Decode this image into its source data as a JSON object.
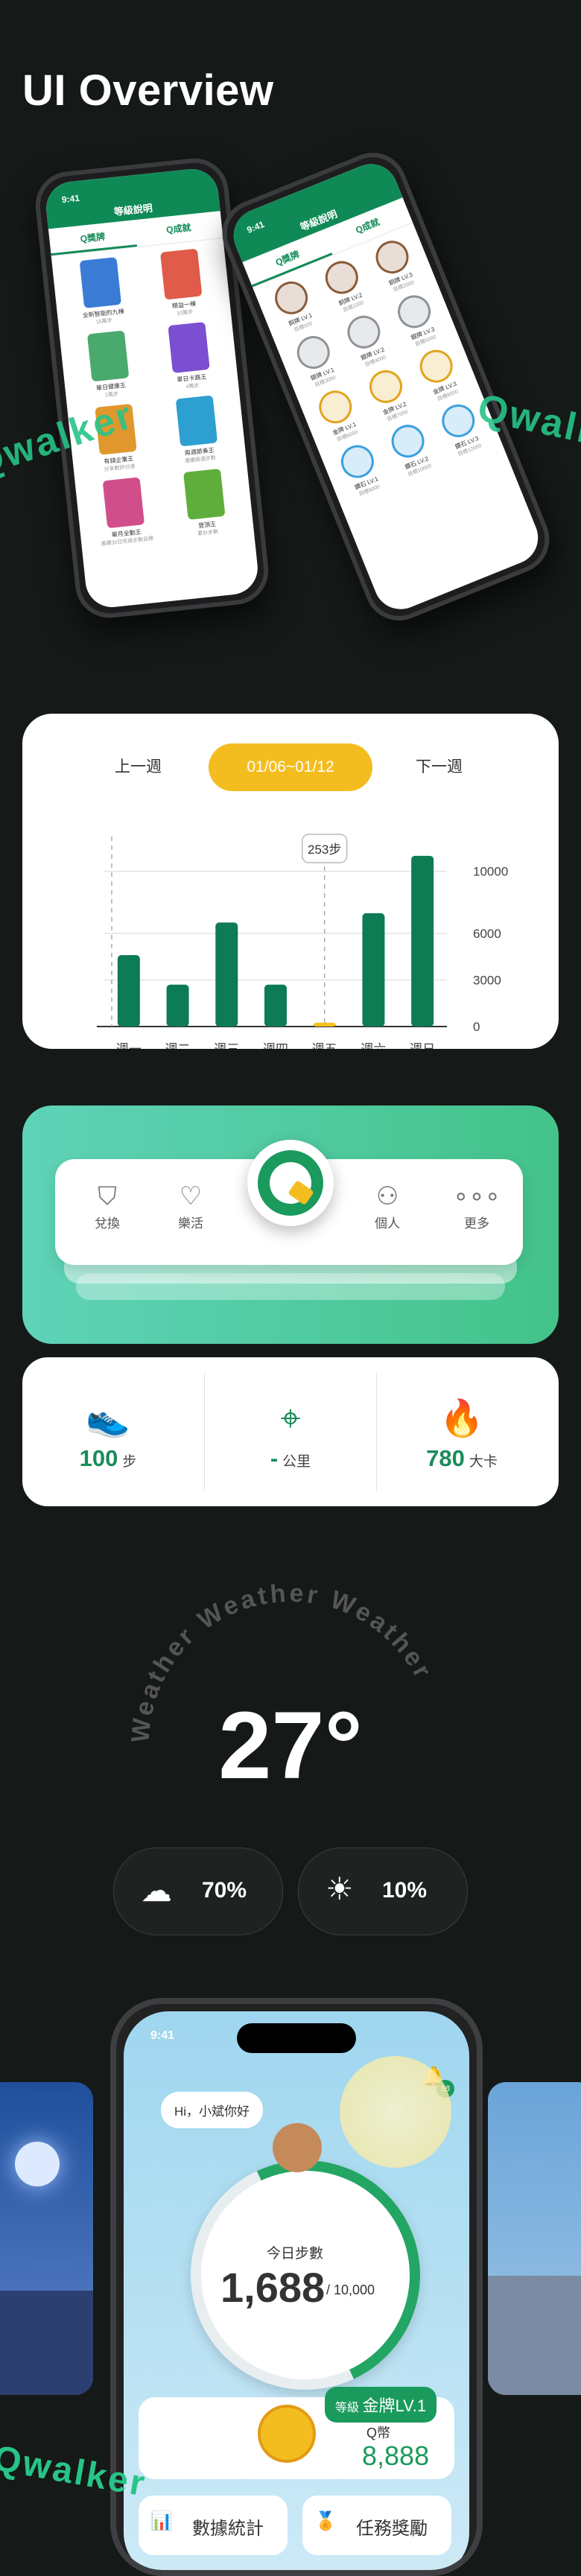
{
  "header": {
    "title": "UI Overview"
  },
  "phone_left": {
    "time": "9:41",
    "screen_title": "等級說明",
    "tabs": [
      "Q獎牌",
      "Q成就"
    ],
    "badges": [
      {
        "name": "全新智能的九棟",
        "desc": "15萬步"
      },
      {
        "name": "精益一棟",
        "desc": "10萬步"
      },
      {
        "name": "單日健康王",
        "desc": "2萬步"
      },
      {
        "name": "單日卡路王",
        "desc": "4萬步"
      },
      {
        "name": "有錢企業王",
        "desc": "分享數評分達"
      },
      {
        "name": "兩週節奏王",
        "desc": "連續兩週步數"
      },
      {
        "name": "單月全勤王",
        "desc": "連續30日完成步數目標"
      },
      {
        "name": "登頂王",
        "desc": "累計步數"
      }
    ]
  },
  "phone_right": {
    "time": "9:41",
    "screen_title": "等級說明",
    "tabs": [
      "Q獎牌",
      "Q成就"
    ],
    "medals": [
      {
        "name": "銅牌 LV.1",
        "desc": "目標500"
      },
      {
        "name": "銅牌 LV.2",
        "desc": "目標1000"
      },
      {
        "name": "銅牌 LV.3",
        "desc": "目標2000"
      },
      {
        "name": "銀牌 LV.1",
        "desc": "目標3000"
      },
      {
        "name": "銀牌 LV.2",
        "desc": "目標4000"
      },
      {
        "name": "銀牌 LV.3",
        "desc": "目標5000"
      },
      {
        "name": "金牌 LV.1",
        "desc": "目標6000"
      },
      {
        "name": "金牌 LV.2",
        "desc": "目標7000"
      },
      {
        "name": "金牌 LV.3",
        "desc": "目標8000"
      },
      {
        "name": "鑽石 LV.1",
        "desc": "目標9000"
      },
      {
        "name": "鑽石 LV.2",
        "desc": "目標10000"
      },
      {
        "name": "鑽石 LV.3",
        "desc": "目標12000"
      }
    ]
  },
  "wordmark": {
    "text": "Qwalker"
  },
  "week_chart": {
    "prev_label": "上一週",
    "next_label": "下一週",
    "range_label": "01/06~01/12",
    "tooltip": "253步",
    "accent_colors": {
      "bar": "#0d7b54",
      "highlight": "#f6c21e"
    }
  },
  "chart_data": {
    "type": "bar",
    "categories": [
      "週一",
      "週二",
      "週三",
      "週四",
      "週五",
      "週六",
      "週日"
    ],
    "values": [
      4600,
      2700,
      6700,
      2700,
      253,
      7300,
      11000
    ],
    "ylim": [
      0,
      12000
    ],
    "yticks": [
      0,
      3000,
      6000,
      10000
    ],
    "highlight_index": 4,
    "grid": true,
    "title": "",
    "xlabel": "",
    "ylabel": ""
  },
  "bottom_nav": {
    "items": [
      {
        "label": "兌換",
        "icon": "redeem-icon"
      },
      {
        "label": "樂活",
        "icon": "heart-icon"
      },
      {
        "label": "個人",
        "icon": "person-icon"
      },
      {
        "label": "更多",
        "icon": "more-icon"
      }
    ]
  },
  "stats": {
    "steps": {
      "value": "100",
      "unit": "步"
    },
    "distance": {
      "value": "-",
      "unit": "公里"
    },
    "calories": {
      "value": "780",
      "unit": "大卡"
    }
  },
  "weather": {
    "ring_text": "Weather Weather Weather",
    "temperature": "27°",
    "rain_chance": "70%",
    "uv": "10%"
  },
  "home_phone": {
    "time": "9:41",
    "notification_count": "88",
    "greeting": "Hi，小斌你好",
    "today_steps_label": "今日步數",
    "today_steps": "1,688",
    "step_goal": "/ 10,000",
    "level_prefix": "等級",
    "level": "金牌LV.1",
    "coin_label": "Q幣",
    "coins": "8,888",
    "menu": [
      "數據統計",
      "任務獎勵"
    ]
  }
}
